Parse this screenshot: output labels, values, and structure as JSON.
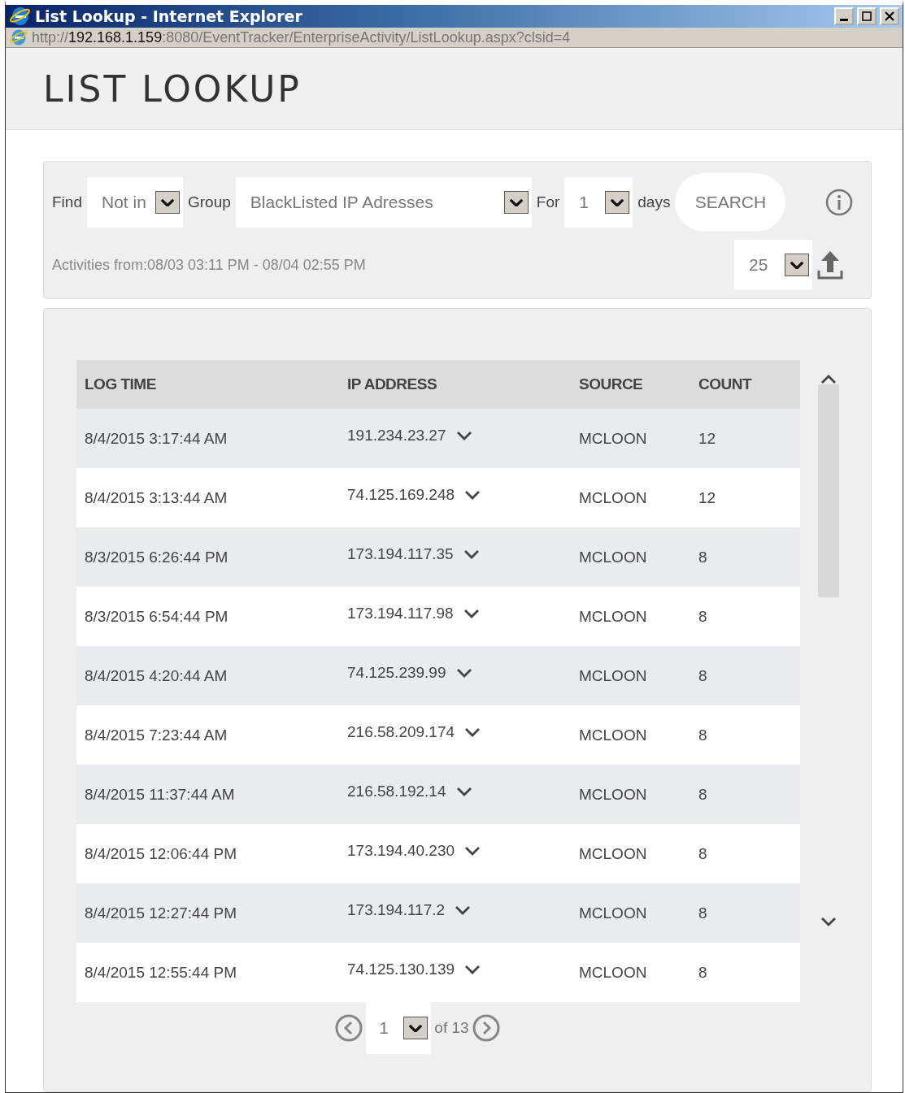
{
  "window": {
    "title": "List Lookup - Internet Explorer"
  },
  "address": {
    "scheme": "http://",
    "host": "192.168.1.159",
    "rest": ":8080/EventTracker/EnterpriseActivity/ListLookup.aspx?clsid=4"
  },
  "page_title": "LIST LOOKUP",
  "filters": {
    "find_label": "Find",
    "find_value": "Not in",
    "group_label": "Group",
    "group_value": "BlackListed IP Adresses",
    "for_label": "For",
    "for_value": "1",
    "days_label": "days",
    "search_button": "SEARCH"
  },
  "range_text": "Activities from:08/03 03:11 PM - 08/04 02:55 PM",
  "page_size": "25",
  "table": {
    "columns": [
      "LOG TIME",
      "IP ADDRESS",
      "SOURCE",
      "COUNT"
    ],
    "rows": [
      [
        "8/4/2015 3:17:44 AM",
        "191.234.23.27",
        "MCLOON",
        "12"
      ],
      [
        "8/4/2015 3:13:44 AM",
        "74.125.169.248",
        "MCLOON",
        "12"
      ],
      [
        "8/3/2015 6:26:44 PM",
        "173.194.117.35",
        "MCLOON",
        "8"
      ],
      [
        "8/3/2015 6:54:44 PM",
        "173.194.117.98",
        "MCLOON",
        "8"
      ],
      [
        "8/4/2015 4:20:44 AM",
        "74.125.239.99",
        "MCLOON",
        "8"
      ],
      [
        "8/4/2015 7:23:44 AM",
        "216.58.209.174",
        "MCLOON",
        "8"
      ],
      [
        "8/4/2015 11:37:44 AM",
        "216.58.192.14",
        "MCLOON",
        "8"
      ],
      [
        "8/4/2015 12:06:44 PM",
        "173.194.40.230",
        "MCLOON",
        "8"
      ],
      [
        "8/4/2015 12:27:44 PM",
        "173.194.117.2",
        "MCLOON",
        "8"
      ],
      [
        "8/4/2015 12:55:44 PM",
        "74.125.130.139",
        "MCLOON",
        "8"
      ]
    ]
  },
  "pagination": {
    "page": "1",
    "of_text": "of 13"
  }
}
